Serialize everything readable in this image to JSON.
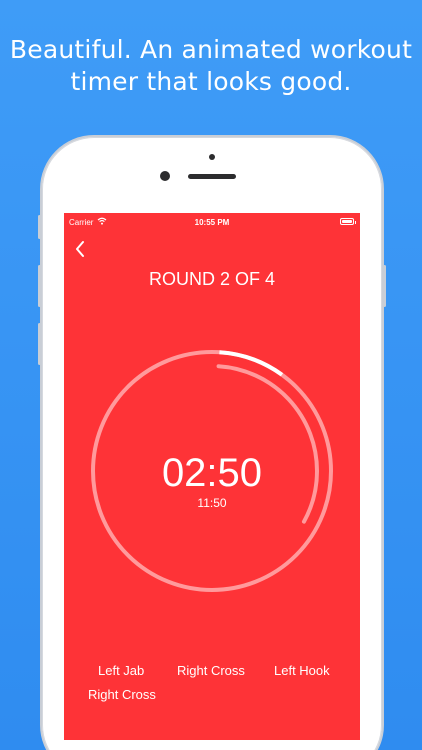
{
  "headline": {
    "line1": "Beautiful. An animated workout",
    "line2": "timer that looks good."
  },
  "status_bar": {
    "carrier": "Carrier",
    "time": "10:55 PM",
    "icons": [
      "wifi-icon",
      "battery-icon"
    ]
  },
  "nav": {
    "back_icon": "chevron-left-icon"
  },
  "timer": {
    "round_title": "ROUND 2 OF 4",
    "remaining": "02:50",
    "total_remaining": "11:50",
    "outer_progress": 0.09,
    "inner_progress": 0.32,
    "colors": {
      "background": "#fe3337",
      "ring": "#ff9a9c",
      "progress": "#ffffff"
    }
  },
  "moves": [
    "Left Jab",
    "Right Cross",
    "Left Hook",
    "Right Cross"
  ]
}
